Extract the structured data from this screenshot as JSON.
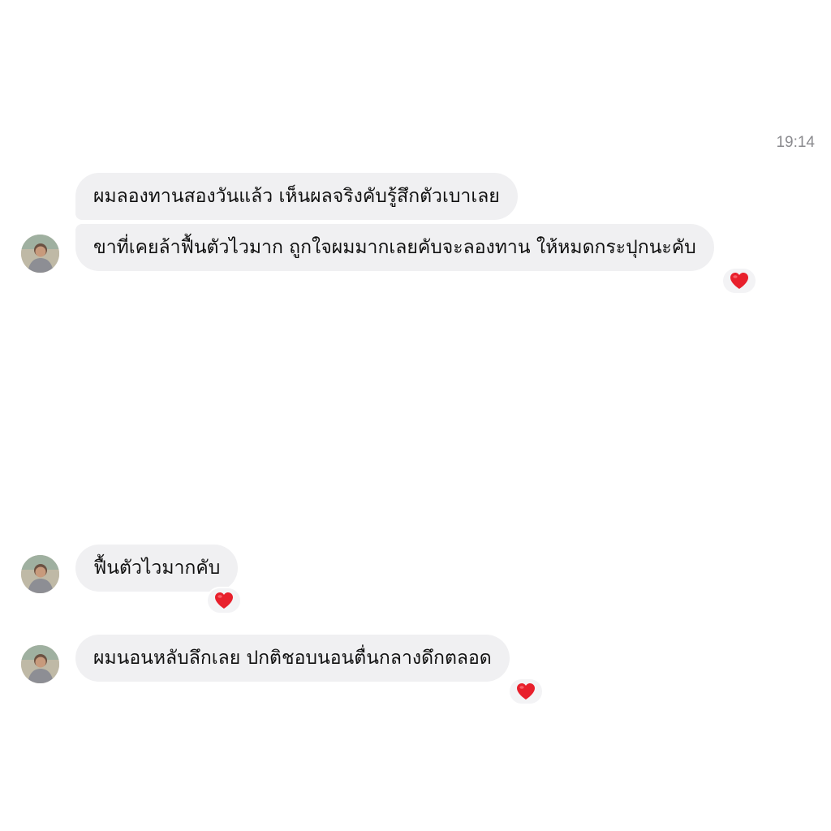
{
  "conversation": {
    "timestamp": "19:14",
    "messages": [
      {
        "text": "ผมลองทานสองวันแล้ว เห็นผลจริงคับรู้สึกตัวเบาเลย",
        "reaction": ""
      },
      {
        "text": "ขาที่เคยล้าฟื้นตัวไวมาก ถูกใจผมมากเลยคับจะลองทาน ให้หมดกระปุกนะคับ",
        "reaction": "heart-icon"
      },
      {
        "text": "ฟื้นตัวไวมากคับ",
        "reaction": "heart-icon"
      },
      {
        "text": "ผมนอนหลับลึกเลย ปกติชอบนอนตื่นกลางดึกตลอด",
        "reaction": "heart-icon"
      }
    ]
  },
  "colors": {
    "bubble": "#f0f0f2",
    "text": "#101010",
    "timestamp": "#8a8a8e",
    "heart": "#e8202c"
  }
}
